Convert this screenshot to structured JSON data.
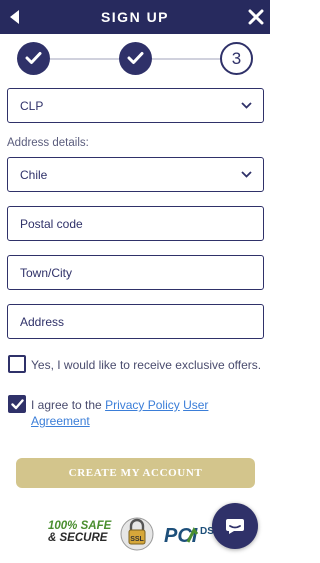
{
  "header": {
    "title": "SIGN UP"
  },
  "stepper": {
    "step3": "3"
  },
  "currency": {
    "value": "CLP"
  },
  "address": {
    "label": "Address details:",
    "country": "Chile",
    "postal_placeholder": "Postal code",
    "town_placeholder": "Town/City",
    "address_placeholder": "Address"
  },
  "consent": {
    "offers_label": "Yes, I would like to receive exclusive offers.",
    "agree_prefix": "I agree to the",
    "privacy_link": "Privacy Policy",
    "user_agreement_link": "User Agreement",
    "offers_checked": false,
    "agree_checked": true
  },
  "actions": {
    "create_label": "CREATE MY ACCOUNT"
  },
  "badges": {
    "safe_line1": "100% SAFE",
    "safe_line2": "& SECURE",
    "ssl": "SSL",
    "pci": "PCI",
    "dss": "DSS"
  },
  "colors": {
    "primary": "#2f3169",
    "header": "#272a5e",
    "button": "#d3c58c",
    "link": "#3b7ed8"
  }
}
